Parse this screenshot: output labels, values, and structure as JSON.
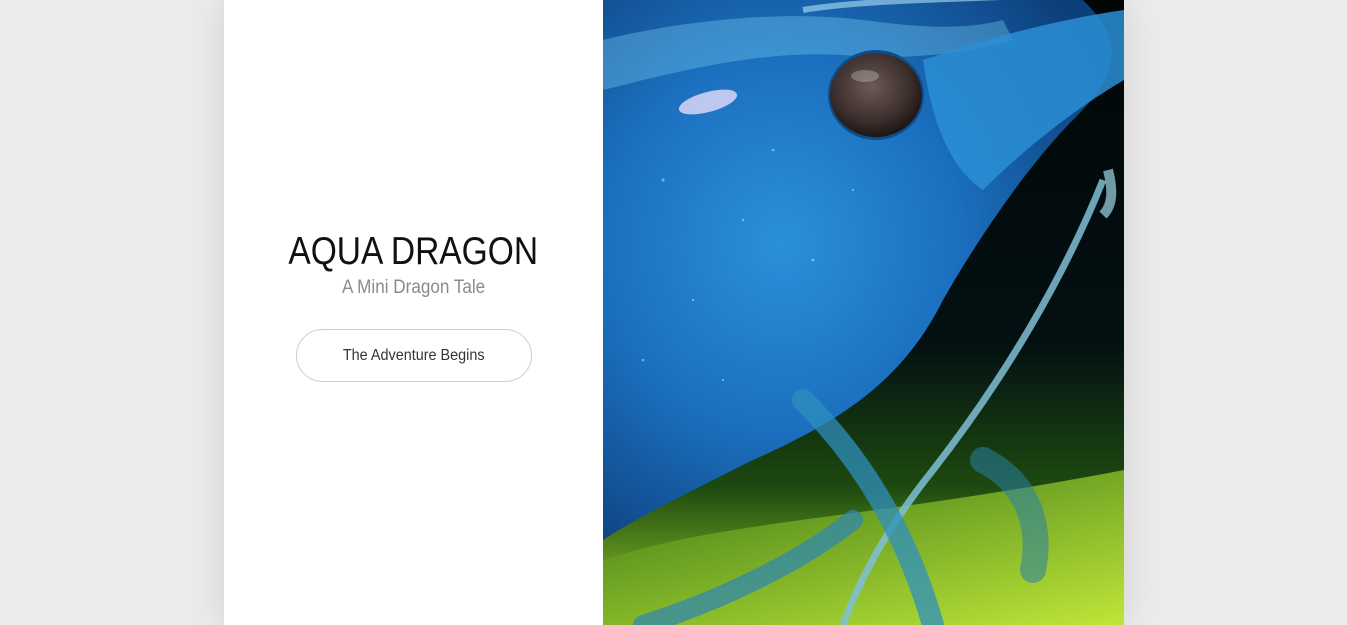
{
  "hero": {
    "title": "AQUA DRAGON",
    "subtitle": "A Mini Dragon Tale",
    "cta_label": "The Adventure Begins"
  },
  "photo": {
    "subject": "blue shrimp close-up",
    "colors": {
      "body": "#1e7fc9",
      "background": "#02080a",
      "algae": "#a6d92b"
    }
  }
}
